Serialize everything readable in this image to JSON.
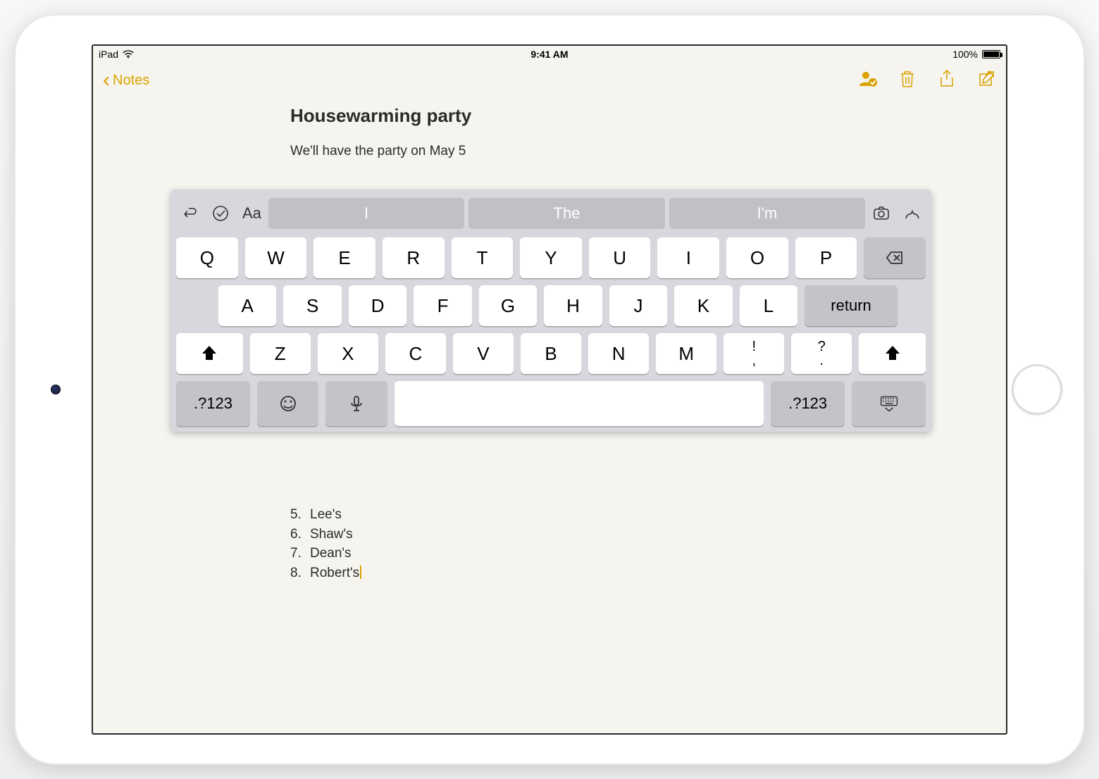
{
  "status": {
    "device": "iPad",
    "time": "9:41 AM",
    "battery_pct": "100%"
  },
  "nav": {
    "back_label": "Notes"
  },
  "note": {
    "title": "Housewarming party",
    "line1": "We'll have the party on May 5",
    "list_below": [
      "Lee's",
      "Shaw's",
      "Dean's",
      "Robert's"
    ]
  },
  "keyboard": {
    "suggestions": [
      "I",
      "The",
      "I'm"
    ],
    "aa_label": "Aa",
    "row1": [
      "Q",
      "W",
      "E",
      "R",
      "T",
      "Y",
      "U",
      "I",
      "O",
      "P"
    ],
    "row2": [
      "A",
      "S",
      "D",
      "F",
      "G",
      "H",
      "J",
      "K",
      "L"
    ],
    "row3": [
      "Z",
      "X",
      "C",
      "V",
      "B",
      "N",
      "M"
    ],
    "punct1_top": "!",
    "punct1_bot": ",",
    "punct2_top": "?",
    "punct2_bot": ".",
    "return_label": "return",
    "numeric_label": ".?123"
  }
}
